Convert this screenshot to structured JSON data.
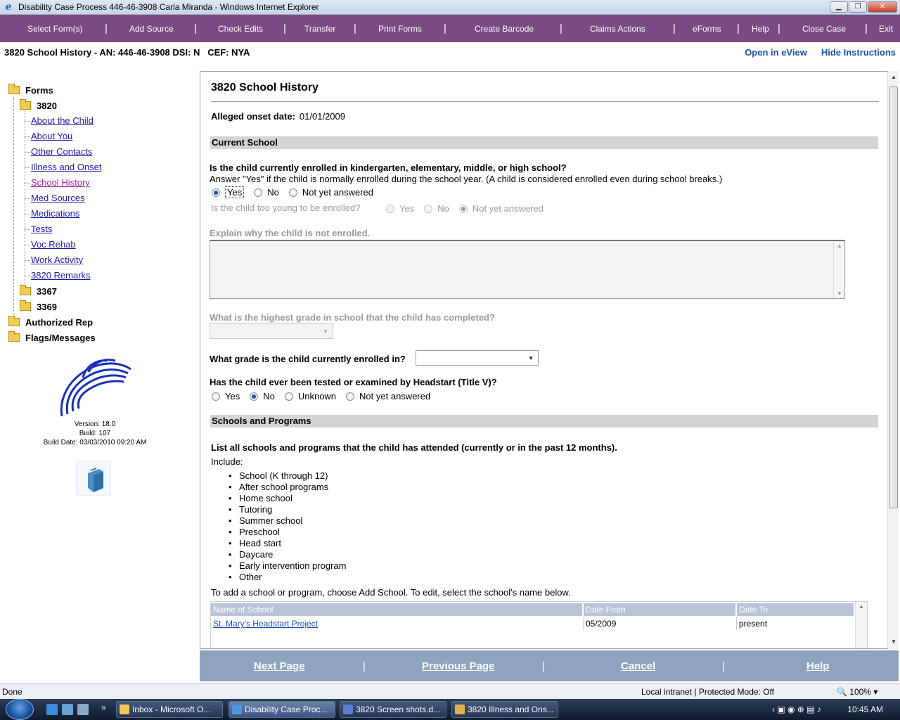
{
  "window": {
    "title": "Disability Case Process 446-46-3908 Carla Miranda - Windows Internet Explorer"
  },
  "menu": {
    "items": [
      "Select Form(s)",
      "Add Source",
      "Check Edits",
      "Transfer",
      "Print Forms",
      "Create Barcode",
      "Claims Actions",
      "eForms",
      "Help",
      "Close Case",
      "Exit"
    ]
  },
  "header": {
    "case_info": "3820 School History - AN: 446-46-3908 DSI: N   CEF: NYA",
    "open_eview": "Open in eView",
    "hide_instructions": "Hide Instructions"
  },
  "nav": {
    "forms": "Forms",
    "form_3820": "3820",
    "links": [
      "About the Child",
      "About You",
      "Other Contacts",
      "Illness and Onset",
      "School History",
      "Med Sources",
      "Medications",
      "Tests",
      "Voc Rehab",
      "Work Activity",
      "3820 Remarks"
    ],
    "active_link": "School History",
    "form_3367": "3367",
    "form_3369": "3369",
    "authorized_rep": "Authorized Rep",
    "flags_messages": "Flags/Messages",
    "version": "Version: 18.0",
    "build": "Build: 107",
    "build_date": "Build Date: 03/03/2010 09:20 AM"
  },
  "form": {
    "title": "3820 School History",
    "onset_label": "Alleged onset date:",
    "onset_value": "01/01/2009",
    "section_current": "Current School",
    "q_enrolled": "Is the child currently enrolled in kindergarten, elementary, middle, or high school?",
    "q_enrolled_help": "Answer \"Yes\" if the child is normally enrolled during the school year. (A child is considered enrolled even during school breaks.)",
    "opt_yes": "Yes",
    "opt_no": "No",
    "opt_not_yet": "Not yet answered",
    "opt_unknown": "Unknown",
    "q_too_young": "Is the child too young to be enrolled?",
    "q_explain": "Explain why the child is not enrolled.",
    "q_highest_grade": "What is the highest grade in school that the child has completed?",
    "q_current_grade": "What grade is the child currently enrolled in?",
    "q_headstart": "Has the child ever been tested or examined by Headstart (Title V)?",
    "section_schools": "Schools and Programs",
    "list_intro": "List all schools and programs that the child has attended (currently or in the past 12 months).",
    "include_label": "Include:",
    "include_items": [
      "School (K through 12)",
      "After school programs",
      "Home school",
      "Tutoring",
      "Summer school",
      "Preschool",
      "Head start",
      "Daycare",
      "Early intervention program",
      "Other"
    ],
    "add_instructions": "To add a school or program, choose Add School. To edit, select the school's name below.",
    "table_headers": [
      "Name of School",
      "Date From",
      "Date To"
    ],
    "table_rows": [
      {
        "name": "St. Mary's Headstart Project",
        "from": "05/2009",
        "to": "present"
      }
    ]
  },
  "bottom_nav": {
    "next": "Next Page",
    "previous": "Previous Page",
    "cancel": "Cancel",
    "help": "Help"
  },
  "status": {
    "done": "Done",
    "zone": "Local intranet | Protected Mode: Off",
    "zoom": "100%"
  },
  "taskbar": {
    "buttons": [
      "Inbox - Microsoft O...",
      "Disability Case Proc...",
      "3820 Screen shots.d...",
      "3820 Illness and Ons..."
    ],
    "clock": "10:45 AM"
  },
  "colors": {
    "menu_bg": "#7a4a85",
    "bottom_nav_bg": "#8ea3bd",
    "section_bg": "#d4d4d4",
    "link": "#1a1aa8",
    "active_link": "#a020a0"
  }
}
